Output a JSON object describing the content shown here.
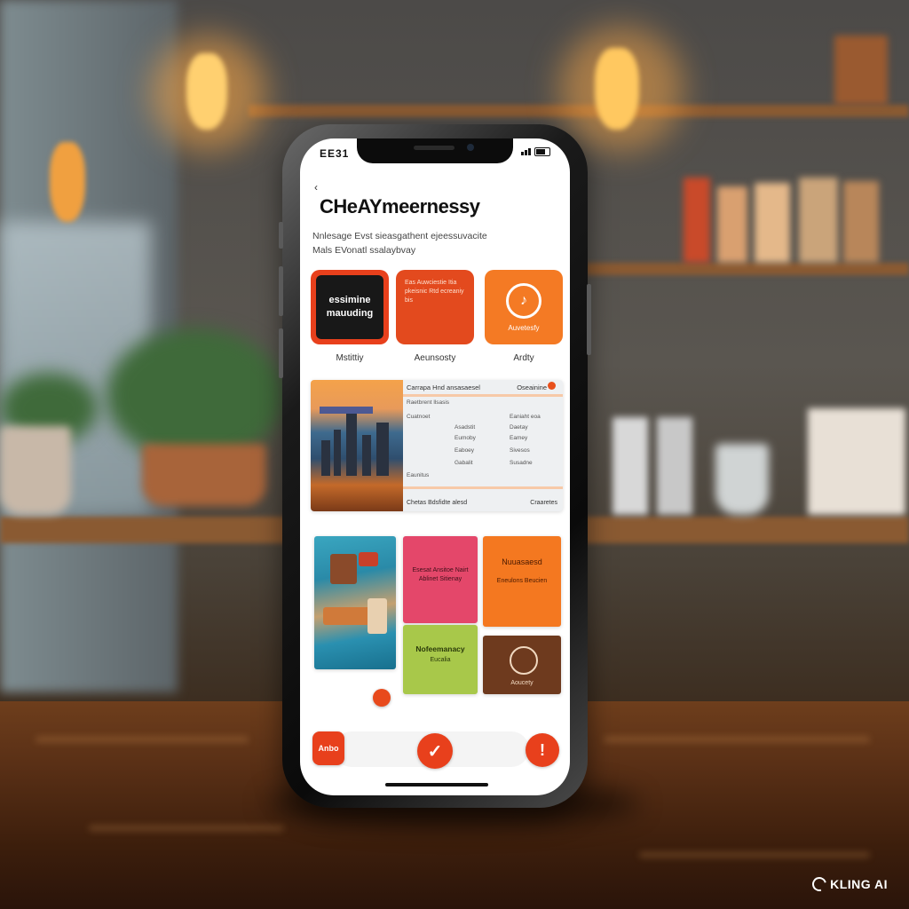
{
  "status_bar": {
    "time": "EE31"
  },
  "header": {
    "back": "‹",
    "title": "CHeAYmeernessy",
    "subtitle_line1": "Nnlesage Evst sieasgathent ejeessuvacite",
    "subtitle_line2": "Mals EVonatl ssalaybvay"
  },
  "categories": [
    {
      "tile_text": "essimine mauuding",
      "label": "Mstittiy"
    },
    {
      "tile_text": "Eas Auwciestie Itia pkeisnic Rtd ecreaniy bis",
      "label": "Aeunsosty"
    },
    {
      "tile_text": "Auvetesfy",
      "label": "Ardty"
    }
  ],
  "feature": {
    "header_left": "Carrapa Hnd ansasaesel",
    "header_right": "Oseainine",
    "rows_left": [
      "Raetbrent llsasis",
      "Cuatnoet",
      "Asadstit",
      "Eumoby",
      "Eaboey",
      "Gabalit",
      "Eaunitus"
    ],
    "rows_right": [
      "Eaniaht eoa",
      "Daetay",
      "Eamey",
      "Sivesos",
      "Susadne"
    ],
    "footer_left": "Chetas Bdsfidte alesd",
    "footer_right": "Craaretes"
  },
  "cards": {
    "pink_text": "Esesat Ansitoe Nairt Ablinet Sitienay",
    "lime_title": "Nofeemanacy",
    "lime_sub": "Eucalia",
    "orange_title": "Nuuasaesd",
    "orange_sub": "Eneulons Beucien",
    "brown_caption": "Aoucety"
  },
  "bottom_nav": {
    "left_label": "Anbo",
    "center_icon": "✓",
    "right_icon": "!"
  },
  "watermark": "KLING AI",
  "colors": {
    "accent": "#e8401c",
    "orange": "#f47820",
    "pink": "#e4476a",
    "lime": "#a8c84a",
    "brown": "#6e3a1e"
  }
}
